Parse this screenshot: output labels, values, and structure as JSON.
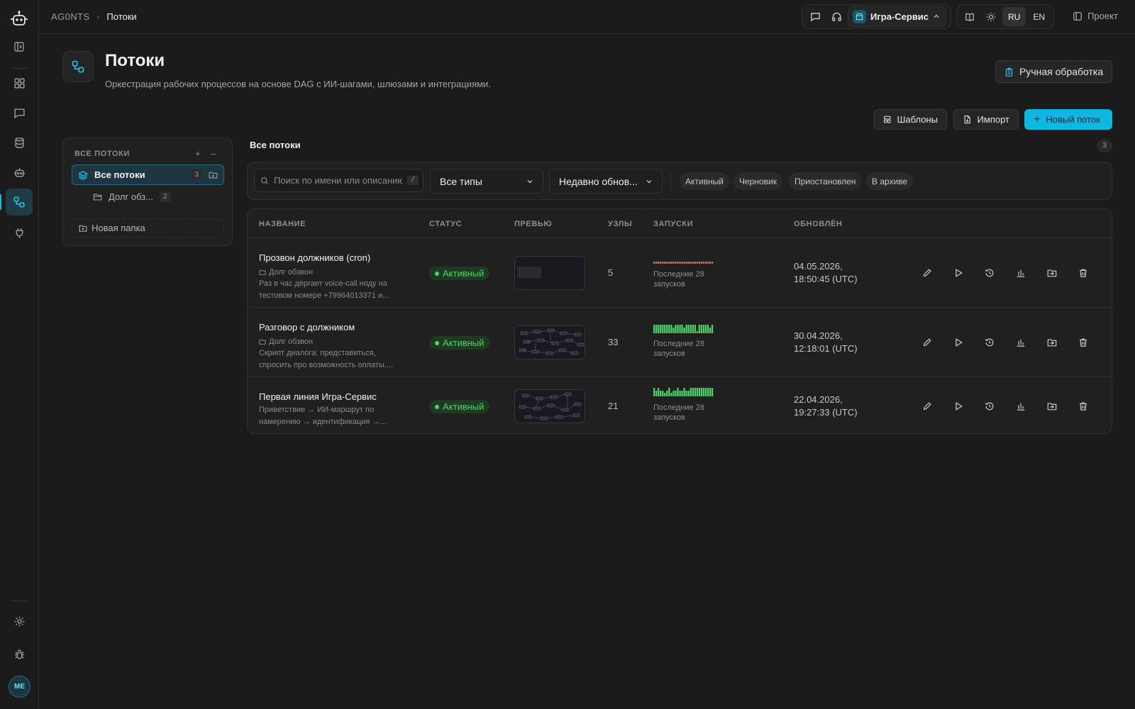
{
  "breadcrumb": {
    "brand": "AG0NTS",
    "current": "Потоки"
  },
  "topbar": {
    "tenant": "Игра-Сервис",
    "lang_ru": "RU",
    "lang_en": "EN",
    "project_label": "Проект"
  },
  "page": {
    "title": "Потоки",
    "subtitle": "Оркестрация рабочих процессов на основе DAG с ИИ-шагами, шлюзами и интеграциями.",
    "manual_btn": "Ручная обработка",
    "templates_btn": "Шаблоны",
    "import_btn": "Импорт",
    "new_flow_btn": "Новый поток"
  },
  "folders": {
    "header": "ВСЕ ПОТОКИ",
    "all_label": "Все потоки",
    "all_count": "3",
    "sub_label": "Долг обз...",
    "sub_count": "2",
    "new_folder": "Новая папка"
  },
  "list": {
    "title": "Все потоки",
    "count": "3"
  },
  "filters": {
    "search_placeholder": "Поиск по имени или описанию...",
    "search_kbd": "/",
    "type_select": "Все типы",
    "sort_select": "Недавно обнов...",
    "chips": [
      "Активный",
      "Черновик",
      "Приостановлен",
      "В архиве"
    ]
  },
  "table": {
    "headers": [
      "НАЗВАНИЕ",
      "СТАТУС",
      "ПРЕВЬЮ",
      "УЗЛЫ",
      "ЗАПУСКИ",
      "ОБНОВЛЁН"
    ],
    "rows": [
      {
        "name": "Прозвон должников (cron)",
        "folder": "Долг обзвон",
        "desc": "Раз в час дёргает voice-call ноду на тестовом номере +79964013371 и...",
        "status": "Активный",
        "nodes": "5",
        "runs_caption": "Последние 28 запусков",
        "updated_date": "04.05.2026,",
        "updated_time": "18:50:45 (UTC)"
      },
      {
        "name": "Разговор с должником",
        "folder": "Долг обзвон",
        "desc": "Скрипт диалога: представиться, спросить про возможность оплаты,...",
        "status": "Активный",
        "nodes": "33",
        "runs_caption": "Последние 28 запусков",
        "updated_date": "30.04.2026,",
        "updated_time": "12:18:01 (UTC)"
      },
      {
        "name": "Первая линия Игра-Сервис",
        "folder": "",
        "desc": "Приветствие → ИИ-маршрут по намерению → идентификация →...",
        "status": "Активный",
        "nodes": "21",
        "runs_caption": "Последние 28 запусков",
        "updated_date": "22.04.2026,",
        "updated_time": "19:27:33 (UTC)"
      }
    ]
  },
  "user": {
    "initials": "ME"
  },
  "colors": {
    "accent": "#0fb6e0",
    "active_green": "#4ed36a",
    "error_red": "#e0636b",
    "background": "#1b1b1b"
  }
}
